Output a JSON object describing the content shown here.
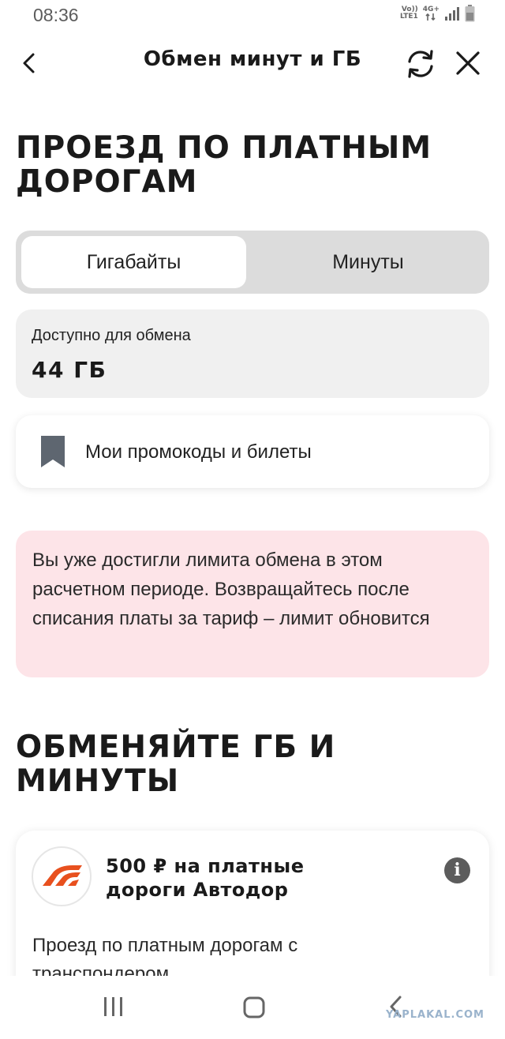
{
  "status_bar": {
    "time": "08:36",
    "volte": "Vo))",
    "lte": "LTE1",
    "network": "4G+"
  },
  "header": {
    "title": "Обмен минут и ГБ",
    "back_icon": "chevron-left-icon",
    "refresh_icon": "refresh-icon",
    "close_icon": "close-icon"
  },
  "page": {
    "heading": "ПРОЕЗД ПО ПЛАТНЫМ ДОРОГАМ"
  },
  "tabs": {
    "items": [
      {
        "label": "Гигабайты",
        "active": true
      },
      {
        "label": "Минуты",
        "active": false
      }
    ]
  },
  "available": {
    "label": "Доступно для обмена",
    "value": "44 ГБ"
  },
  "promo": {
    "label": "Мои промокоды и билеты",
    "icon": "bookmark-icon"
  },
  "warning": {
    "text": "Вы уже достигли лимита обмена в этом расчетном периоде. Возвращайтесь после списания платы за тариф – лимит обновится"
  },
  "exchange_section": {
    "heading": "ОБМЕНЯЙТЕ ГБ И МИНУТЫ"
  },
  "offer": {
    "title": "500 ₽ на платные дороги Автодор",
    "description": "Проезд по платным дорогам с транспондером",
    "info_icon": "info-icon",
    "logo_icon": "avtodor-logo-icon"
  },
  "navbar": {
    "recents_icon": "recents-icon",
    "home_icon": "home-icon",
    "back_icon": "back-icon"
  },
  "watermark": "YAPLAKAL.COM",
  "colors": {
    "warning_bg": "#fde4e8",
    "segment_bg": "#dcdcdc",
    "card_bg": "#f0f0f0",
    "brand_orange": "#e8501e",
    "icon_gray": "#5c5c5c"
  }
}
